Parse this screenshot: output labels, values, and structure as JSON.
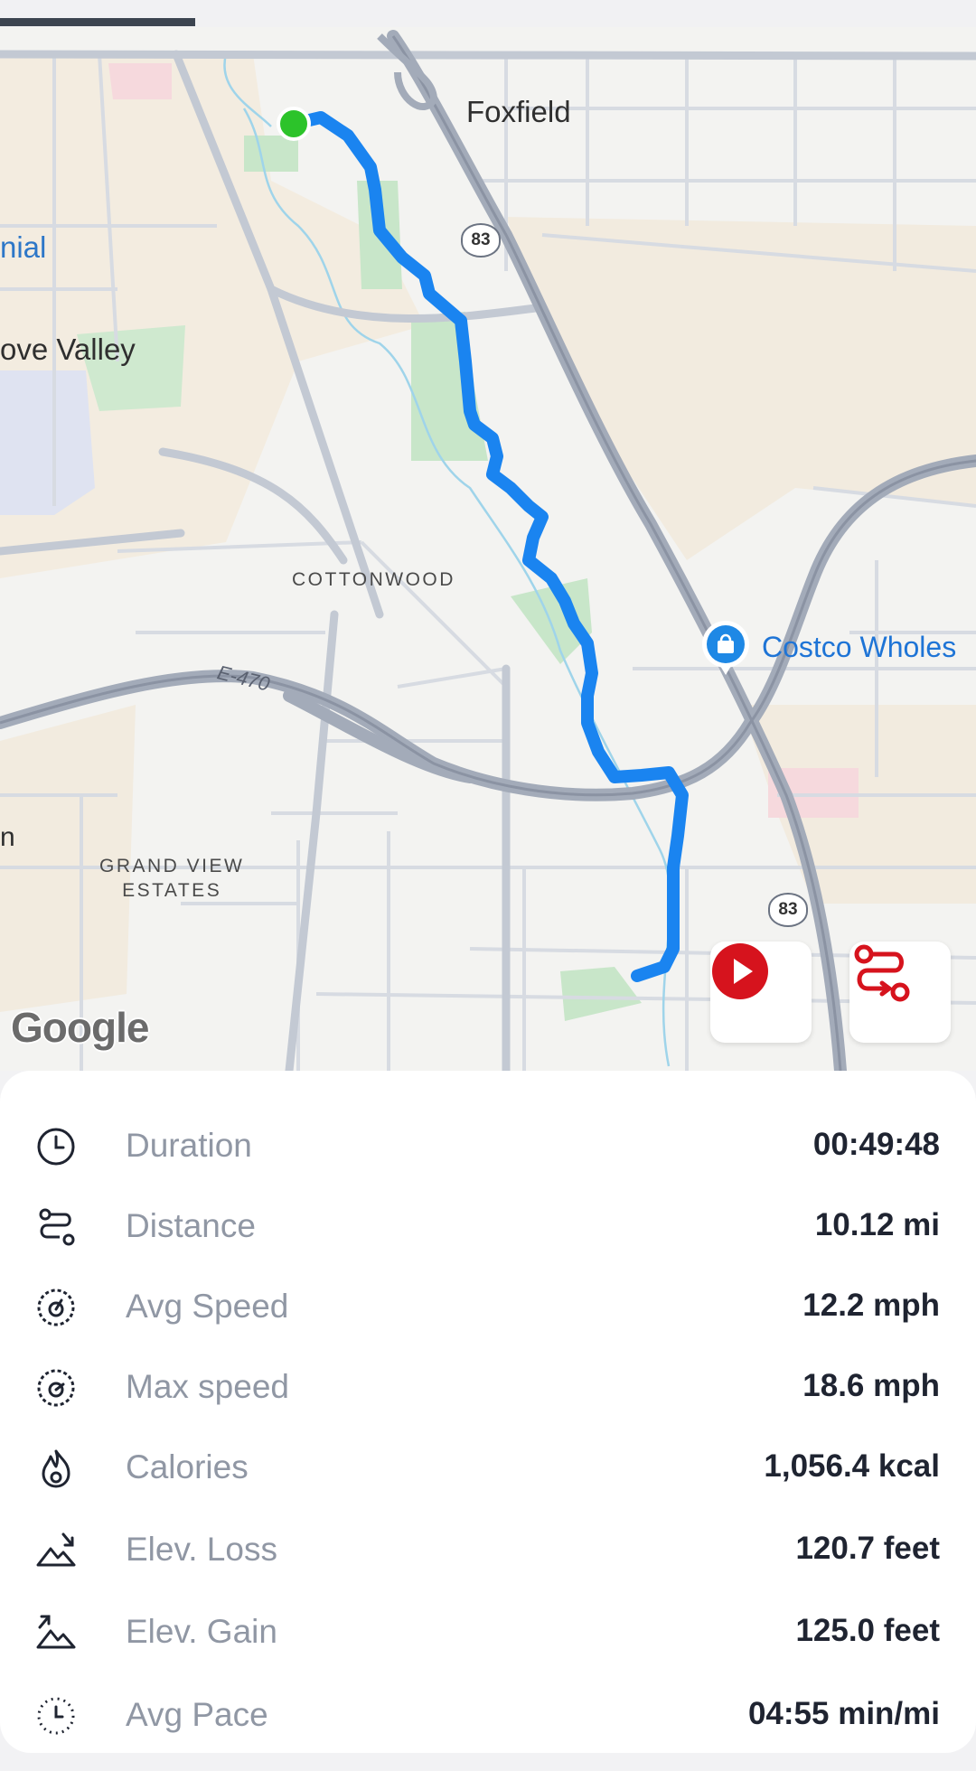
{
  "map": {
    "places": {
      "foxfield": "Foxfield",
      "nial": "nial",
      "ove_valley": "ove Valley",
      "cottonwood": "COTTONWOOD",
      "grand_view_estates": "GRAND VIEW\nESTATES",
      "edge_n": "n"
    },
    "roads": {
      "e470": "E-470",
      "hwy83_top": "83",
      "hwy83_bottom": "83"
    },
    "poi": {
      "costco": "Costco Wholes"
    },
    "attribution": "Google",
    "route_color": "#1a84f0",
    "start_marker_color": "#2cc32a",
    "play_button_icon": "play-icon",
    "route_button_icon": "route-icon"
  },
  "stats": [
    {
      "icon": "clock-icon",
      "label": "Duration",
      "value": "00:49:48"
    },
    {
      "icon": "route-icon",
      "label": "Distance",
      "value": "10.12 mi"
    },
    {
      "icon": "speedometer-icon",
      "label": "Avg Speed",
      "value": "12.2 mph"
    },
    {
      "icon": "speedometer-icon",
      "label": "Max speed",
      "value": "18.6 mph"
    },
    {
      "icon": "flame-icon",
      "label": "Calories",
      "value": "1,056.4 kcal"
    },
    {
      "icon": "elevation-loss-icon",
      "label": "Elev. Loss",
      "value": "120.7 feet"
    },
    {
      "icon": "elevation-gain-icon",
      "label": "Elev. Gain",
      "value": "125.0 feet"
    },
    {
      "icon": "pace-icon",
      "label": "Avg Pace",
      "value": "04:55 min/mi"
    }
  ]
}
